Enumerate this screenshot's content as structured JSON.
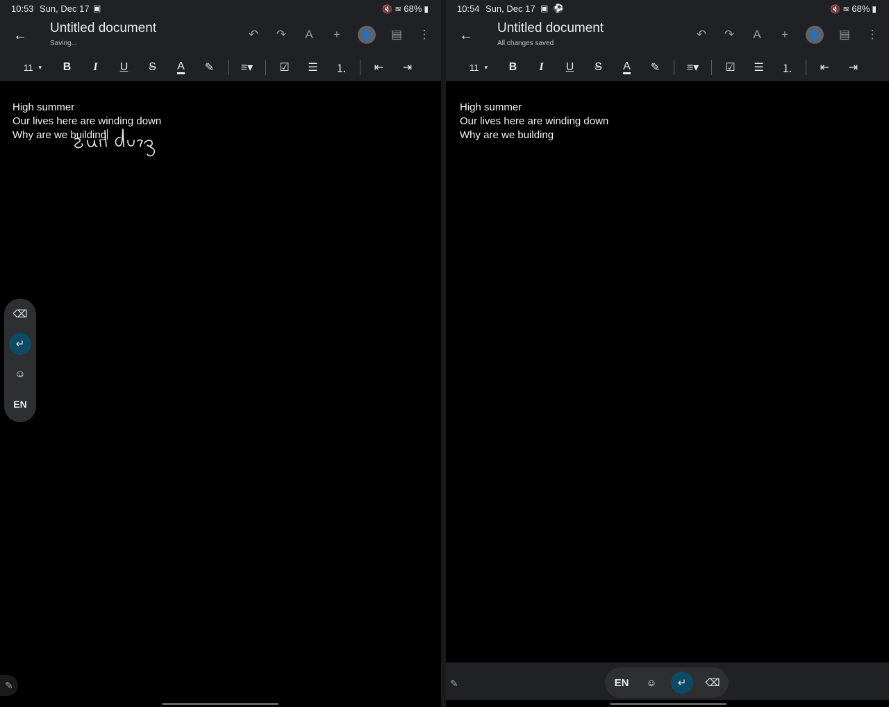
{
  "left": {
    "status": {
      "time": "10:53",
      "date": "Sun, Dec 17",
      "notif_icons": "▣",
      "right_icons": "🔇 ≋",
      "battery": "68%"
    },
    "title": "Untitled document",
    "save_status": "Saving...",
    "font_size": "11",
    "body_lines": [
      "High summer",
      "Our lives here are winding down",
      "Why are we building"
    ]
  },
  "right": {
    "status": {
      "time": "10:54",
      "date": "Sun, Dec 17",
      "notif_icons": "▣ ⚽",
      "right_icons": "🔇 ≋",
      "battery": "68%"
    },
    "title": "Untitled document",
    "save_status": "All changes saved",
    "font_size": "11",
    "body_lines": [
      "High summer",
      "Our lives here are winding down",
      "Why are we building"
    ]
  },
  "keyboard": {
    "language": "EN"
  },
  "icons": {
    "back": "←",
    "undo": "↶",
    "redo": "↷",
    "text_format": "A",
    "insert": "+",
    "share": "👤",
    "comment": "▤",
    "more": "⋮",
    "bold": "B",
    "italic": "I",
    "underline": "U",
    "strike": "S",
    "text_color": "A",
    "highlight": "✎",
    "align": "≡▾",
    "checklist": "☑",
    "bullets": "☰",
    "numbered": "⒈",
    "indent_less": "⇤",
    "indent_more": "⇥",
    "caret": "▾",
    "backspace": "⌫",
    "enter": "↵",
    "emoji": "☺",
    "pen": "✎",
    "battery": "▮"
  },
  "colors": {
    "toolbar_bg": "#202124",
    "accent": "#0d4a66"
  }
}
